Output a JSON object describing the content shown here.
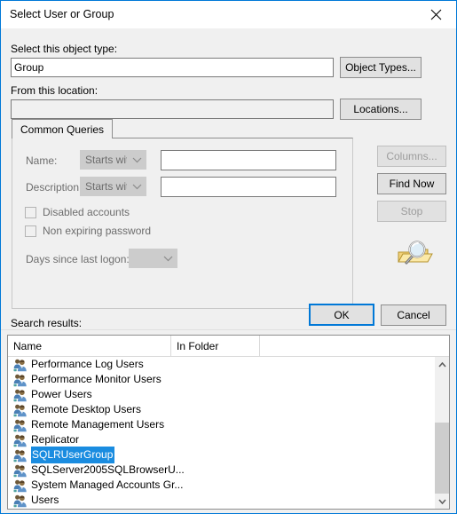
{
  "window": {
    "title": "Select User or Group",
    "close_icon": "close-icon",
    "border_color": "#0078d7"
  },
  "object_type": {
    "label": "Select this object type:",
    "value": "Group",
    "button": "Object Types..."
  },
  "location": {
    "label": "From this location:",
    "value": "",
    "button": "Locations..."
  },
  "tabs": [
    {
      "label": "Common Queries",
      "active": true
    }
  ],
  "query": {
    "name_label": "Name:",
    "name_condition": "Starts with",
    "name_value": "",
    "description_label": "Description:",
    "description_condition": "Starts with",
    "description_value": "",
    "disabled_accounts_label": "Disabled accounts",
    "disabled_accounts_checked": false,
    "non_expiring_label": "Non expiring password",
    "non_expiring_checked": false,
    "days_label": "Days since last logon:",
    "days_value": ""
  },
  "side_buttons": {
    "columns": "Columns...",
    "columns_enabled": false,
    "find_now": "Find Now",
    "find_now_enabled": true,
    "stop": "Stop",
    "stop_enabled": false,
    "graphic_icon": "magnifier-folder-icon"
  },
  "dialog_buttons": {
    "ok": "OK",
    "cancel": "Cancel"
  },
  "results": {
    "label": "Search results:",
    "columns": [
      "Name",
      "In Folder"
    ],
    "rows": [
      {
        "name": "Performance Log Users",
        "folder": "",
        "selected": false
      },
      {
        "name": "Performance Monitor Users",
        "folder": "",
        "selected": false
      },
      {
        "name": "Power Users",
        "folder": "",
        "selected": false
      },
      {
        "name": "Remote Desktop Users",
        "folder": "",
        "selected": false
      },
      {
        "name": "Remote Management Users",
        "folder": "",
        "selected": false
      },
      {
        "name": "Replicator",
        "folder": "",
        "selected": false
      },
      {
        "name": "SQLRUserGroup",
        "folder": "",
        "selected": true
      },
      {
        "name": "SQLServer2005SQLBrowserU...",
        "folder": "",
        "selected": false
      },
      {
        "name": "System Managed Accounts Gr...",
        "folder": "",
        "selected": false
      },
      {
        "name": "Users",
        "folder": "",
        "selected": false
      }
    ],
    "selection_color": "#1a8ce0",
    "row_icon": "group-users-icon",
    "scrollbar": {
      "up_icon": "chevron-up-icon",
      "down_icon": "chevron-down-icon"
    }
  }
}
